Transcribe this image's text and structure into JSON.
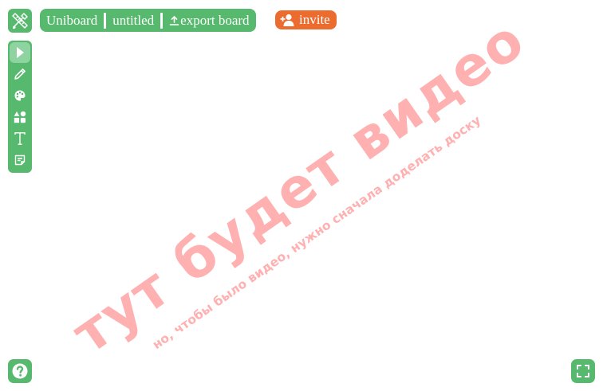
{
  "topbar": {
    "app_name": "Uniboard",
    "board_name": "untitled",
    "export_label": "export board"
  },
  "invite": {
    "label": "invite"
  },
  "toolbar": {
    "tools": [
      {
        "name": "select",
        "icon": "cursor-icon",
        "active": true
      },
      {
        "name": "pen",
        "icon": "pencil-icon",
        "active": false
      },
      {
        "name": "color",
        "icon": "palette-icon",
        "active": false
      },
      {
        "name": "shapes",
        "icon": "shapes-icon",
        "active": false
      },
      {
        "name": "text",
        "icon": "text-icon",
        "active": false
      },
      {
        "name": "sticky-note",
        "icon": "note-icon",
        "active": false
      }
    ]
  },
  "watermark": {
    "main": "тут будет видео",
    "sub": "но, чтобы было видео, нужно сначала доделать  доску"
  },
  "colors": {
    "accent": "#57b96d",
    "accent_active": "#8fd3a0",
    "invite": "#ec6c2f",
    "watermark": "#ffb0b0"
  },
  "icons": {
    "logo": "brush-ruler-icon",
    "help": "question-icon",
    "fullscreen": "fullscreen-icon"
  }
}
